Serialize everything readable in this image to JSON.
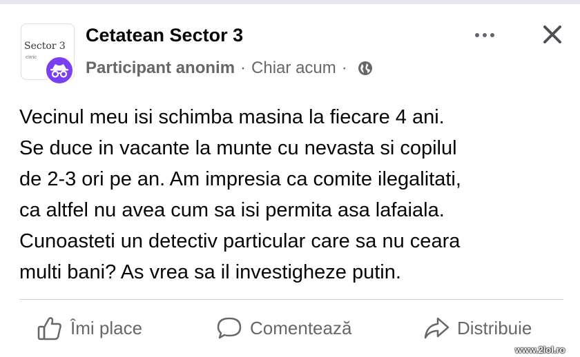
{
  "header": {
    "group_logo_text": "Sector 3",
    "group_logo_subtext": "civic",
    "group_name": "Cetatean Sector 3",
    "author": "Participant anonim",
    "separator": "·",
    "timestamp": "Chiar acum",
    "separator2": "·",
    "privacy_icon": "globe-icon",
    "more_icon": "more-horizontal-icon",
    "close_icon": "close-icon"
  },
  "post": {
    "lines": [
      "Vecinul meu isi schimba masina la fiecare 4 ani.",
      "Se duce in vacante la munte cu nevasta si copilul",
      "de 2-3 ori pe an. Am impresia ca comite ilegalitati,",
      "ca altfel nu avea cum sa isi permita asa lafaiala.",
      "Cunoasteti un detectiv particular care sa nu ceara",
      "multi bani? As vrea sa il investigheze putin."
    ]
  },
  "actions": {
    "like_label": "Îmi place",
    "comment_label": "Comentează",
    "share_label": "Distribuie"
  },
  "watermark": "www.2lol.ro",
  "colors": {
    "anon_badge": "#7b3ff2",
    "secondary_text": "#65676b",
    "primary_text": "#050505",
    "divider": "#ced0d4"
  }
}
